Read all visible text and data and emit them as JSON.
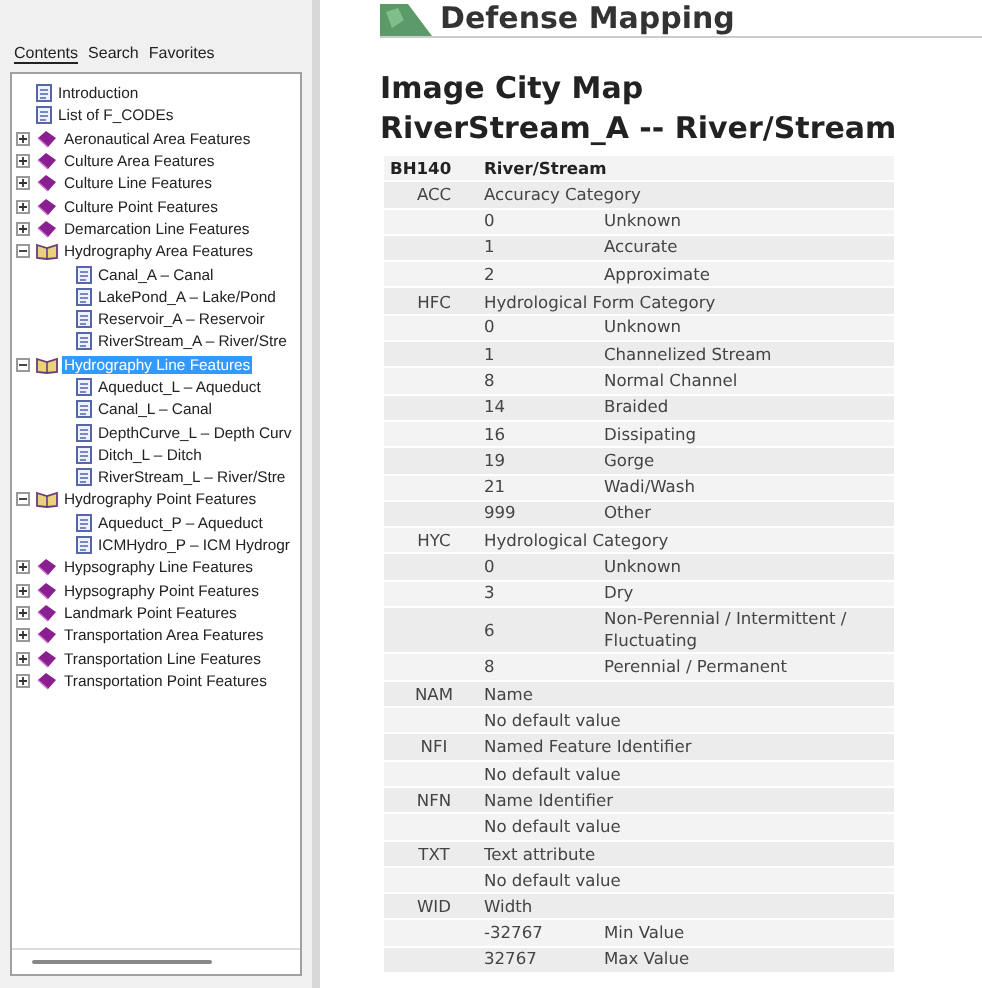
{
  "nav_tabs": [
    {
      "label": "Contents",
      "selected": true
    },
    {
      "label": "Search",
      "selected": false
    },
    {
      "label": "Favorites",
      "selected": false
    }
  ],
  "tree": [
    {
      "label": "Introduction",
      "kind": "page",
      "selected": false
    },
    {
      "label": "List of F_CODEs",
      "kind": "page",
      "selected": false
    },
    {
      "label": "Aeronautical Area Features",
      "kind": "book",
      "expanded": false,
      "selected": false
    },
    {
      "label": "Culture Area Features",
      "kind": "book",
      "expanded": false,
      "selected": false
    },
    {
      "label": "Culture Line Features",
      "kind": "book",
      "expanded": false,
      "selected": false
    },
    {
      "label": "Culture Point Features",
      "kind": "book",
      "expanded": false,
      "selected": false
    },
    {
      "label": "Demarcation Line Features",
      "kind": "book",
      "expanded": false,
      "selected": false
    },
    {
      "label": "Hydrography Area Features",
      "kind": "book",
      "expanded": true,
      "selected": false,
      "children": [
        {
          "label": "Canal_A – Canal",
          "kind": "page",
          "selected": false
        },
        {
          "label": "LakePond_A – Lake/Pond",
          "kind": "page",
          "selected": false
        },
        {
          "label": "Reservoir_A – Reservoir",
          "kind": "page",
          "selected": false
        },
        {
          "label": "RiverStream_A – River/Stre",
          "kind": "page",
          "selected": false
        }
      ]
    },
    {
      "label": "Hydrography Line Features",
      "kind": "book",
      "expanded": true,
      "selected": true,
      "children": [
        {
          "label": "Aqueduct_L – Aqueduct",
          "kind": "page",
          "selected": false
        },
        {
          "label": "Canal_L – Canal",
          "kind": "page",
          "selected": false
        },
        {
          "label": "DepthCurve_L – Depth Curv",
          "kind": "page",
          "selected": false
        },
        {
          "label": "Ditch_L – Ditch",
          "kind": "page",
          "selected": false
        },
        {
          "label": "RiverStream_L – River/Stre",
          "kind": "page",
          "selected": false
        }
      ]
    },
    {
      "label": "Hydrography Point Features",
      "kind": "book",
      "expanded": true,
      "selected": false,
      "children": [
        {
          "label": "Aqueduct_P – Aqueduct",
          "kind": "page",
          "selected": false
        },
        {
          "label": "ICMHydro_P – ICM Hydrogr",
          "kind": "page",
          "selected": false
        }
      ]
    },
    {
      "label": "Hypsography Line Features",
      "kind": "book",
      "expanded": false,
      "selected": false
    },
    {
      "label": "Hypsography Point Features",
      "kind": "book",
      "expanded": false,
      "selected": false
    },
    {
      "label": "Landmark Point Features",
      "kind": "book",
      "expanded": false,
      "selected": false
    },
    {
      "label": "Transportation Area Features",
      "kind": "book",
      "expanded": false,
      "selected": false
    },
    {
      "label": "Transportation Line Features",
      "kind": "book",
      "expanded": false,
      "selected": false
    },
    {
      "label": "Transportation Point Features",
      "kind": "book",
      "expanded": false,
      "selected": false
    }
  ],
  "banner": {
    "title": "Defense Mapping"
  },
  "page_title": "Image City Map",
  "page_subtitle": "RiverStream_A -- River/Stream",
  "table": {
    "rows": [
      {
        "kind": "header",
        "code": "BH140",
        "name": "River/Stream"
      },
      {
        "kind": "attribute",
        "code": "ACC",
        "name": "Accuracy Category"
      },
      {
        "kind": "value",
        "value": "0",
        "meaning": "Unknown"
      },
      {
        "kind": "value",
        "value": "1",
        "meaning": "Accurate"
      },
      {
        "kind": "value",
        "value": "2",
        "meaning": "Approximate"
      },
      {
        "kind": "attribute",
        "code": "HFC",
        "name": "Hydrological Form Category"
      },
      {
        "kind": "value",
        "value": "0",
        "meaning": "Unknown"
      },
      {
        "kind": "value",
        "value": "1",
        "meaning": "Channelized Stream"
      },
      {
        "kind": "value",
        "value": "8",
        "meaning": "Normal Channel"
      },
      {
        "kind": "value",
        "value": "14",
        "meaning": "Braided"
      },
      {
        "kind": "value",
        "value": "16",
        "meaning": "Dissipating"
      },
      {
        "kind": "value",
        "value": "19",
        "meaning": "Gorge"
      },
      {
        "kind": "value",
        "value": "21",
        "meaning": "Wadi/Wash"
      },
      {
        "kind": "value",
        "value": "999",
        "meaning": "Other"
      },
      {
        "kind": "attribute",
        "code": "HYC",
        "name": "Hydrological Category"
      },
      {
        "kind": "value",
        "value": "0",
        "meaning": "Unknown"
      },
      {
        "kind": "value",
        "value": "3",
        "meaning": "Dry"
      },
      {
        "kind": "value",
        "value": "6",
        "meaning": "Non-Perennial / Intermittent / Fluctuating"
      },
      {
        "kind": "value",
        "value": "8",
        "meaning": "Perennial / Permanent"
      },
      {
        "kind": "attribute",
        "code": "NAM",
        "name": "Name"
      },
      {
        "kind": "note",
        "text": "No default value"
      },
      {
        "kind": "attribute",
        "code": "NFI",
        "name": "Named Feature Identifier"
      },
      {
        "kind": "note",
        "text": "No default value"
      },
      {
        "kind": "attribute",
        "code": "NFN",
        "name": "Name Identifier"
      },
      {
        "kind": "note",
        "text": "No default value"
      },
      {
        "kind": "attribute",
        "code": "TXT",
        "name": "Text attribute"
      },
      {
        "kind": "note",
        "text": "No default value"
      },
      {
        "kind": "attribute",
        "code": "WID",
        "name": "Width"
      },
      {
        "kind": "value",
        "value": "-32767",
        "meaning": "Min Value"
      },
      {
        "kind": "value",
        "value": "32767",
        "meaning": "Max Value"
      }
    ]
  }
}
